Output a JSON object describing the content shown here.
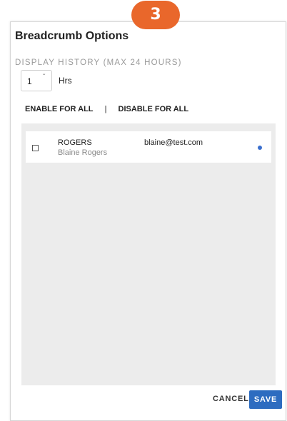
{
  "step_badge": "3",
  "dialog": {
    "title": "Breadcrumb Options",
    "section_label": "DISPLAY HISTORY (MAX 24 HOURS)",
    "hours_value": "1",
    "hours_unit": "Hrs",
    "enable_all_label": "ENABLE FOR ALL",
    "separator": "|",
    "disable_all_label": "DISABLE FOR ALL"
  },
  "users": [
    {
      "name": "ROGERS",
      "full_name": "Blaine Rogers",
      "email": "blaine@test.com",
      "checked": false,
      "status_color": "#3a6fce"
    }
  ],
  "footer": {
    "cancel_label": "CANCEL",
    "save_label": "SAVE"
  },
  "colors": {
    "accent": "#2d6cc0",
    "badge": "#e9672b",
    "list_bg": "#ececec"
  }
}
